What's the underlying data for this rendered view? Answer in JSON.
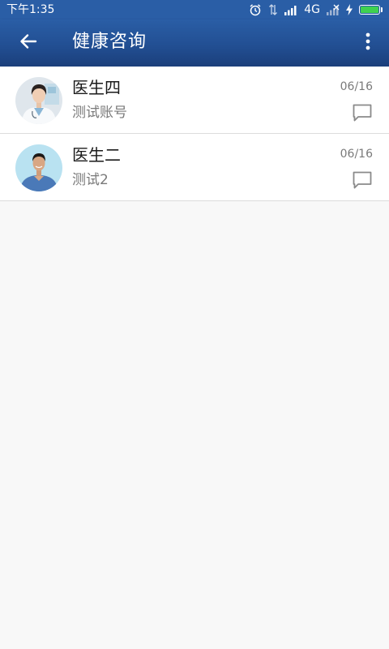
{
  "status_bar": {
    "time": "下午1:35",
    "network": "4G"
  },
  "toolbar": {
    "title": "健康咨询"
  },
  "consultations": [
    {
      "name": "医生四",
      "subtitle": "测试账号",
      "date": "06/16"
    },
    {
      "name": "医生二",
      "subtitle": "测试2",
      "date": "06/16"
    }
  ],
  "colors": {
    "toolbar_top": "#2a5ea6",
    "toolbar_bottom": "#1b3f7b",
    "background": "#f8f8f8",
    "battery_fill": "#3fd14f"
  },
  "icons": {
    "back": "arrow-left-icon",
    "more": "more-vertical-icon",
    "chat": "chat-bubble-icon",
    "alarm": "alarm-icon",
    "data": "data-arrows-icon",
    "signal": "signal-icon",
    "charging": "lightning-icon",
    "battery": "battery-icon"
  }
}
